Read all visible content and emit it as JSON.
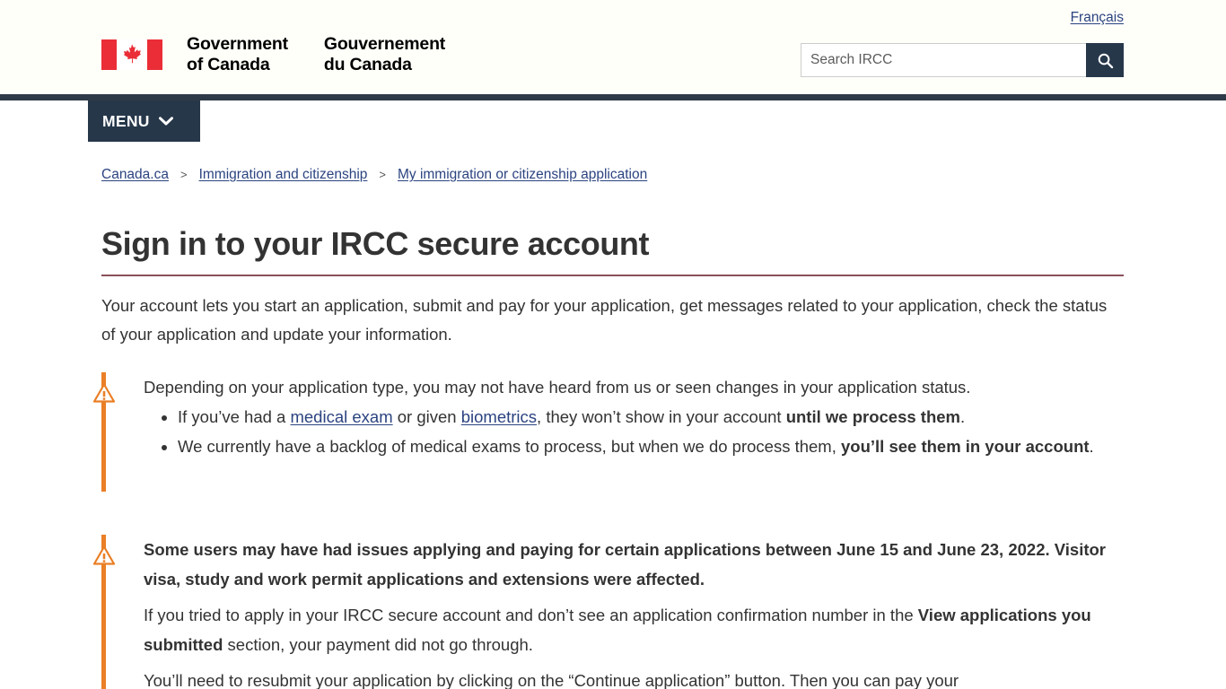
{
  "header": {
    "lang_link": "Français",
    "brand_en_line1": "Government",
    "brand_en_line2": "of Canada",
    "brand_fr_line1": "Gouvernement",
    "brand_fr_line2": "du Canada",
    "flag_icon": "canada-flag-icon",
    "search_placeholder": "Search IRCC",
    "search_value": "",
    "search_icon": "search-icon",
    "menu_label": "MENU",
    "menu_icon": "chevron-down-icon"
  },
  "breadcrumb": {
    "items": [
      {
        "label": "Canada.ca"
      },
      {
        "label": "Immigration and citizenship"
      },
      {
        "label": "My immigration or citizenship application"
      }
    ],
    "separator": ">"
  },
  "main": {
    "title": "Sign in to your IRCC secure account",
    "intro": "Your account lets you start an application, submit and pay for your application, get messages related to your application, check the status of your application and update your information."
  },
  "alerts": [
    {
      "icon": "warning-triangle-icon",
      "lead": "Depending on your application type, you may not have heard from us or seen changes in your application status.",
      "bullets": [
        {
          "part1": "If you’ve had a ",
          "link1": "medical exam",
          "part2": " or given ",
          "link2": "biometrics",
          "part3": ", they won’t show in your account ",
          "bold1": "until we process them",
          "part4": "."
        },
        {
          "part1": "We currently have a backlog of medical exams to process, but when we do process them, ",
          "bold1": "you’ll see them in your account",
          "part2": "."
        }
      ]
    },
    {
      "icon": "warning-triangle-icon",
      "headline": "Some users may have had issues applying and paying for certain applications between June 15 and June 23, 2022. Visitor visa, study and work permit applications and extensions were affected.",
      "body1_part1": "If you tried to apply in your IRCC secure account and don’t see an application confirmation number in the ",
      "body1_bold": "View applications you submitted",
      "body1_part2": " section, your payment did not go through.",
      "body2": "You’ll need to resubmit your application by clicking on the “Continue application” button. Then you can pay your"
    }
  ],
  "colors": {
    "nav_dark": "#26374a",
    "alert_orange": "#e97f26",
    "link_blue": "#2b4380",
    "title_rule": "#8a4f5a",
    "flag_red": "#ea2d37"
  }
}
